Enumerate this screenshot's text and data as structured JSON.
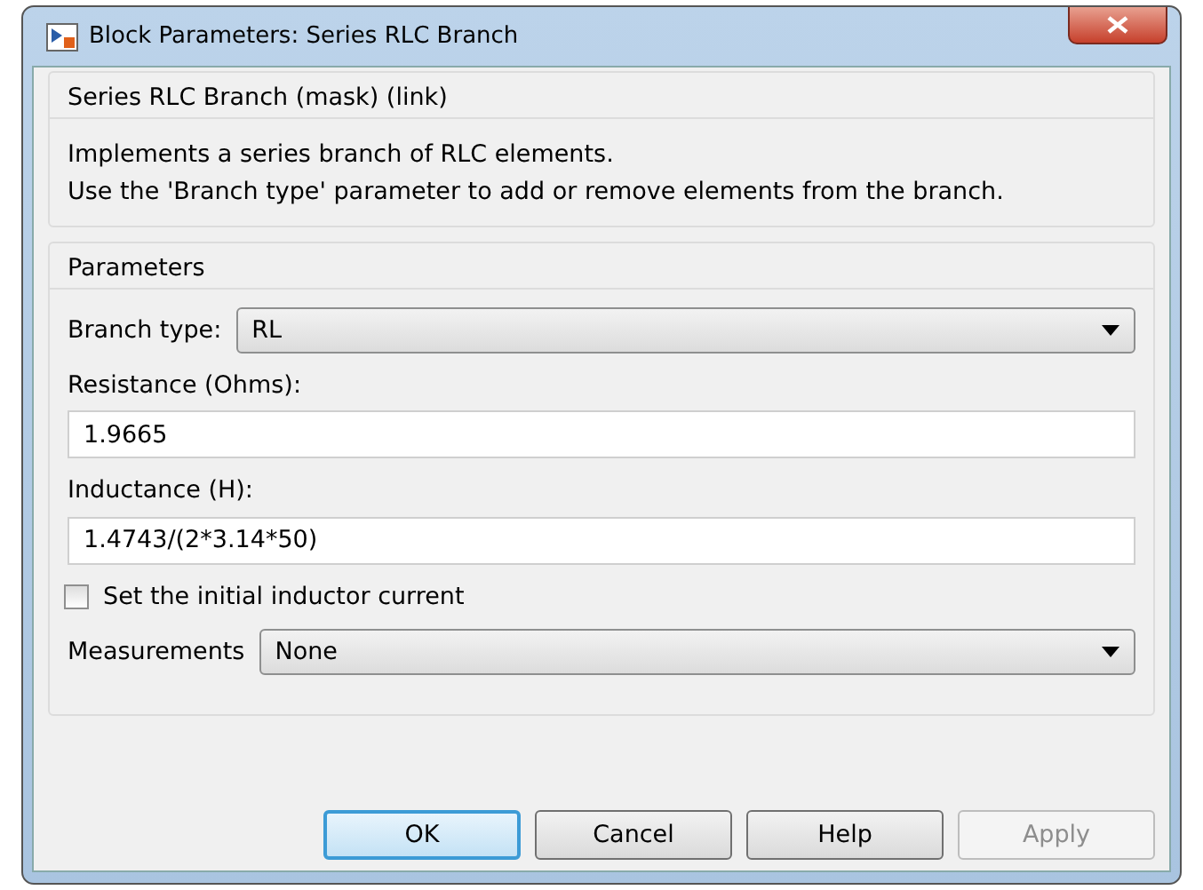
{
  "window": {
    "title": "Block Parameters: Series RLC Branch"
  },
  "description": {
    "title": "Series RLC Branch (mask) (link)",
    "text": "Implements a series branch of RLC elements.\nUse the 'Branch type' parameter to add or remove elements from the branch."
  },
  "parameters": {
    "title": "Parameters",
    "items": [
      {
        "kind": "dropdown",
        "label": "Branch type:",
        "value": "RL"
      },
      {
        "kind": "text",
        "label": "Resistance (Ohms):",
        "value": "1.9665"
      },
      {
        "kind": "text",
        "label": "Inductance (H):",
        "value": "1.4743/(2*3.14*50)"
      },
      {
        "kind": "checkbox",
        "label": "Set the initial inductor current",
        "checked": false
      },
      {
        "kind": "dropdown",
        "label": "Measurements",
        "value": "None"
      }
    ]
  },
  "buttons": [
    {
      "label": "OK",
      "default": true,
      "disabled": false
    },
    {
      "label": "Cancel",
      "default": false,
      "disabled": false
    },
    {
      "label": "Help",
      "default": false,
      "disabled": false
    },
    {
      "label": "Apply",
      "default": false,
      "disabled": true
    }
  ]
}
